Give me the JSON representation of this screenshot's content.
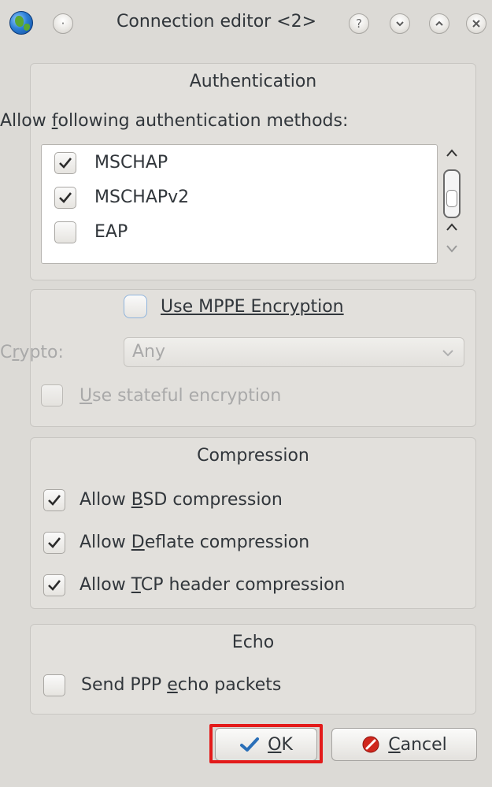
{
  "window": {
    "title": "Connection editor <2>",
    "buttons": [
      "help",
      "minimize",
      "maximize",
      "close"
    ]
  },
  "authentication": {
    "title": "Authentication",
    "prompt": "Allow following authentication methods:",
    "methods": [
      {
        "label": "MSCHAP",
        "checked": true
      },
      {
        "label": "MSCHAPv2",
        "checked": true
      },
      {
        "label": "EAP",
        "checked": false
      }
    ]
  },
  "mppe": {
    "use_label": "Use MPPE Encryption",
    "checked": false,
    "crypto_label": "Crypto:",
    "crypto_value": "Any",
    "stateful_label": "Use stateful encryption",
    "stateful_checked": false
  },
  "compression": {
    "title": "Compression",
    "options": [
      {
        "label": "Allow BSD compression",
        "checked": true
      },
      {
        "label": "Allow Deflate compression",
        "checked": true
      },
      {
        "label": "Allow TCP header compression",
        "checked": true
      }
    ]
  },
  "echo": {
    "title": "Echo",
    "send_label": "Send PPP echo packets",
    "checked": false
  },
  "actions": {
    "ok_label": "OK",
    "cancel_label": "Cancel"
  },
  "colors": {
    "highlight": "#e31a1a",
    "ok_icon": "#2a6fb8",
    "cancel_icon": "#d0271d"
  },
  "icons": [
    "app-globe-icon",
    "shade-icon",
    "help-icon",
    "minimize-icon",
    "maximize-icon",
    "close-icon",
    "checkmark-icon",
    "ok-check-icon",
    "cancel-icon",
    "chevron-down-icon"
  ]
}
